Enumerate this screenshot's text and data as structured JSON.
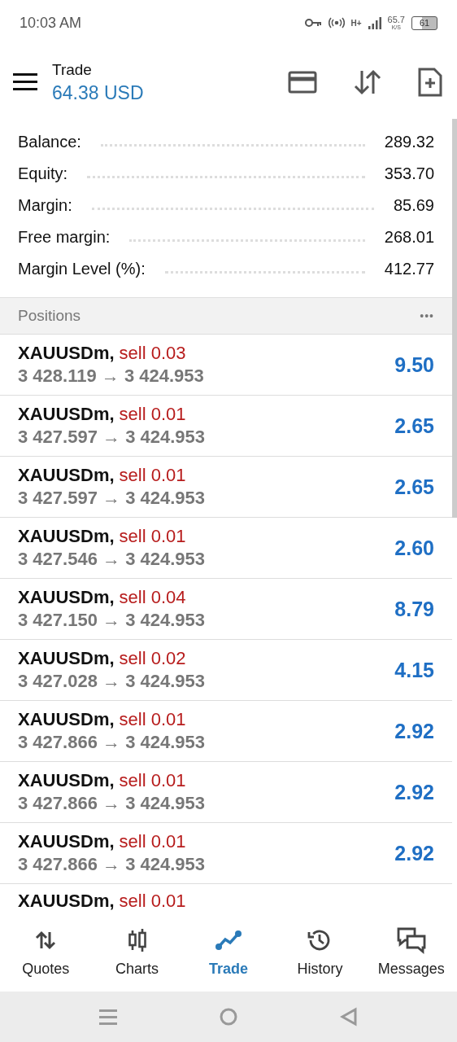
{
  "status_bar": {
    "time": "10:03 AM",
    "network_type": "H+",
    "network_speed": "65.7",
    "speed_unit": "K/S",
    "battery": "61"
  },
  "header": {
    "title": "Trade",
    "balance": "64.38 USD"
  },
  "account": [
    {
      "label": "Balance:",
      "value": "289.32"
    },
    {
      "label": "Equity:",
      "value": "353.70"
    },
    {
      "label": "Margin:",
      "value": "85.69"
    },
    {
      "label": "Free margin:",
      "value": "268.01"
    },
    {
      "label": "Margin Level (%):",
      "value": "412.77"
    }
  ],
  "positions": {
    "title": "Positions",
    "more": "•••",
    "rows": [
      {
        "symbol": "XAUUSDm,",
        "side": "sell 0.03",
        "open_price": "3 428.119",
        "arrow": "→",
        "current_price": "3 424.953",
        "profit": "9.50"
      },
      {
        "symbol": "XAUUSDm,",
        "side": "sell 0.01",
        "open_price": "3 427.597",
        "arrow": "→",
        "current_price": "3 424.953",
        "profit": "2.65"
      },
      {
        "symbol": "XAUUSDm,",
        "side": "sell 0.01",
        "open_price": "3 427.597",
        "arrow": "→",
        "current_price": "3 424.953",
        "profit": "2.65"
      },
      {
        "symbol": "XAUUSDm,",
        "side": "sell 0.01",
        "open_price": "3 427.546",
        "arrow": "→",
        "current_price": "3 424.953",
        "profit": "2.60"
      },
      {
        "symbol": "XAUUSDm,",
        "side": "sell 0.04",
        "open_price": "3 427.150",
        "arrow": "→",
        "current_price": "3 424.953",
        "profit": "8.79"
      },
      {
        "symbol": "XAUUSDm,",
        "side": "sell 0.02",
        "open_price": "3 427.028",
        "arrow": "→",
        "current_price": "3 424.953",
        "profit": "4.15"
      },
      {
        "symbol": "XAUUSDm,",
        "side": "sell 0.01",
        "open_price": "3 427.866",
        "arrow": "→",
        "current_price": "3 424.953",
        "profit": "2.92"
      },
      {
        "symbol": "XAUUSDm,",
        "side": "sell 0.01",
        "open_price": "3 427.866",
        "arrow": "→",
        "current_price": "3 424.953",
        "profit": "2.92"
      },
      {
        "symbol": "XAUUSDm,",
        "side": "sell 0.01",
        "open_price": "3 427.866",
        "arrow": "→",
        "current_price": "3 424.953",
        "profit": "2.92"
      },
      {
        "symbol": "XAUUSDm,",
        "side": "sell 0.01"
      }
    ]
  },
  "nav": [
    {
      "label": "Quotes",
      "selected": false
    },
    {
      "label": "Charts",
      "selected": false
    },
    {
      "label": "Trade",
      "selected": true
    },
    {
      "label": "History",
      "selected": false
    },
    {
      "label": "Messages",
      "selected": false
    }
  ]
}
